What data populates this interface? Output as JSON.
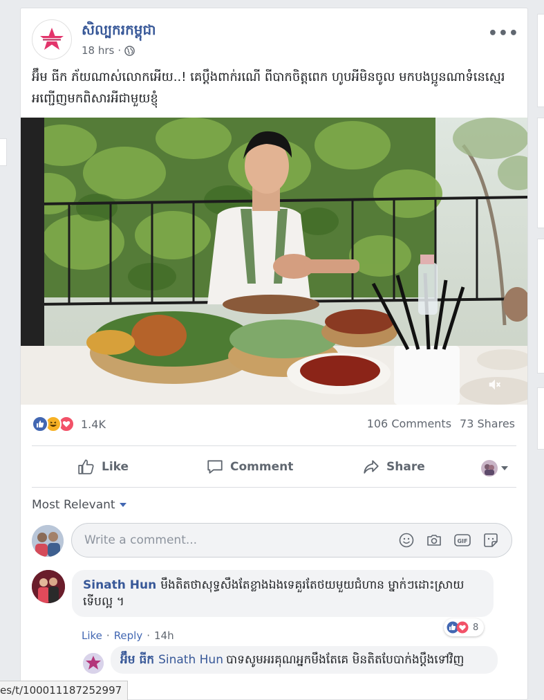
{
  "post": {
    "page_name": "សិល្បករកម្ពុជា",
    "time": "18 hrs",
    "more": "•••",
    "caption": "អ៊ឹម ធីក ភ័យណាស់លោកអើយ..! គេប្ដឹងពាក់រណើ ពីបាកចិត្តពេក ហូបអីមិនចូល មកបងប្អូនណាទំនេស្មេរអញ្ជើញមកពិសារអីជាមួយខ្ញុំ"
  },
  "reactions": {
    "count": "1.4K",
    "icons": [
      "like-reaction",
      "haha-reaction",
      "love-reaction"
    ],
    "comments": "106 Comments",
    "shares": "73 Shares"
  },
  "actions": {
    "like": "Like",
    "comment": "Comment",
    "share": "Share"
  },
  "comments": {
    "sort_label": "Most Relevant",
    "composer_placeholder": "Write a comment...",
    "items": [
      {
        "author": "Sinath Hun",
        "text": "មឹងតិតថាសុទ្ធសឹងតែខ្លាងឯងទេគួរតែថយមួយជំហាន ម្នាក់ៗដោះស្រាយទើបល្អ ។",
        "like": "Like",
        "reply": "Reply",
        "time": "14h",
        "reaction_count": "8"
      }
    ],
    "reply": {
      "author": "អ៊ឹម ធីក",
      "tag": "Sinath Hun",
      "text": "បាទសូមអរគុណអ្នកមឹងតែគេ មិនតិតបែបាក់ងប្ដឹងទៅវិញ"
    }
  },
  "statusbar": {
    "url": "es/t/100011187252997"
  },
  "colors": {
    "link": "#385898",
    "accent": "#4267b2",
    "love": "#f25268",
    "haha": "#f7b125"
  }
}
